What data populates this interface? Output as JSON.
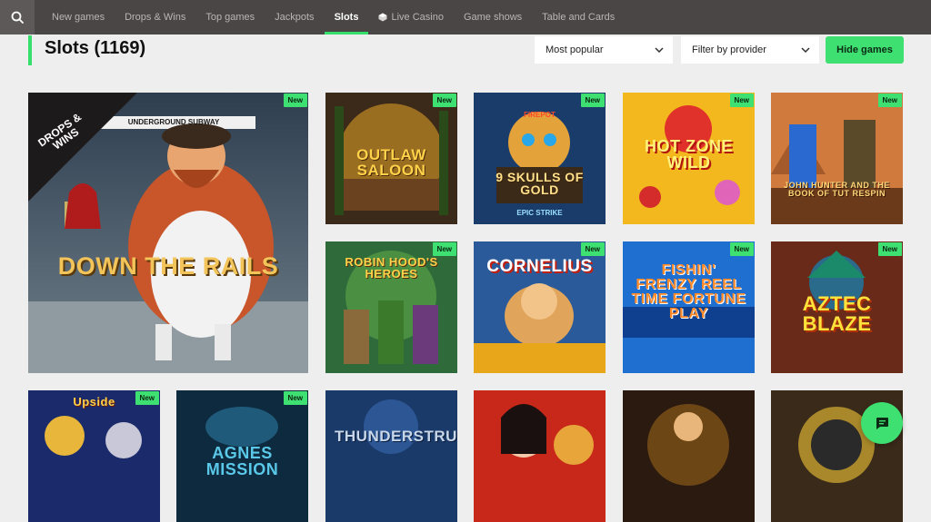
{
  "nav": {
    "items": [
      {
        "label": "New games",
        "active": false
      },
      {
        "label": "Drops & Wins",
        "active": false
      },
      {
        "label": "Top games",
        "active": false
      },
      {
        "label": "Jackpots",
        "active": false
      },
      {
        "label": "Slots",
        "active": true
      },
      {
        "label": "Live Casino",
        "active": false,
        "icon": "live-casino-icon"
      },
      {
        "label": "Game shows",
        "active": false
      },
      {
        "label": "Table and Cards",
        "active": false
      }
    ]
  },
  "header": {
    "title": "Slots (1169)",
    "sort_selected": "Most popular",
    "provider_selected": "Filter by provider",
    "hide_label": "Hide games"
  },
  "games": [
    {
      "title": "DOWN THE RAILS",
      "badge": "New",
      "ribbon": "DROPS & WINS",
      "sign": "UNDERGROUND SUBWAY"
    },
    {
      "title": "OUTLAW SALOON",
      "badge": "New"
    },
    {
      "title": "9 SKULLS OF GOLD",
      "badge": "New",
      "top": "FIREPOT",
      "sub": "EPIC STRIKE"
    },
    {
      "title": "HOT ZONE WILD",
      "badge": "New"
    },
    {
      "title": "JOHN HUNTER AND THE BOOK OF TUT RESPIN",
      "badge": "New"
    },
    {
      "title": "ROBIN HOOD'S HEROES",
      "badge": "New"
    },
    {
      "title": "CORNELIUS",
      "badge": "New"
    },
    {
      "title": "FISHIN' FRENZY REEL TIME FORTUNE PLAY",
      "badge": "New"
    },
    {
      "title": "AZTEC BLAZE",
      "badge": "New"
    },
    {
      "title": "Upside",
      "badge": "New"
    },
    {
      "title": "AGNES MISSION",
      "badge": "New"
    },
    {
      "title": "THUNDERSTRUCK",
      "badge": ""
    },
    {
      "title": "",
      "badge": ""
    },
    {
      "title": "",
      "badge": ""
    },
    {
      "title": "",
      "badge": ""
    }
  ],
  "colors": {
    "accent": "#3ee071",
    "nav_bg": "#4a4646",
    "page_bg": "#eeeeee"
  }
}
